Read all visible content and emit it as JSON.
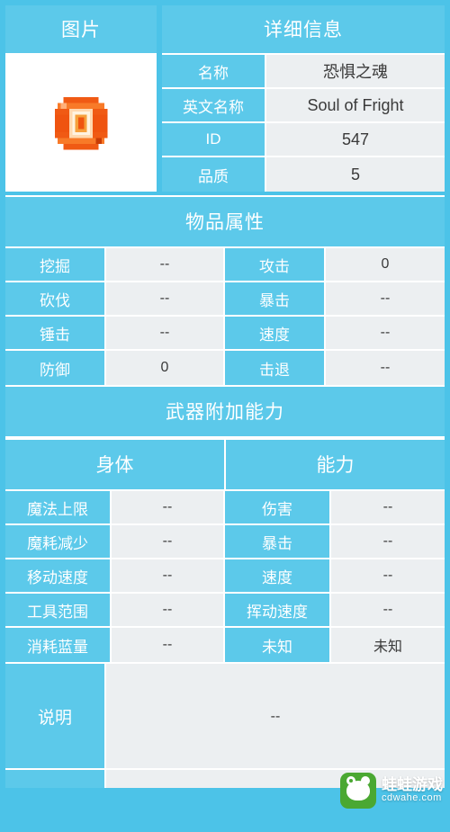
{
  "header": {
    "image_title": "图片",
    "detail_title": "详细信息"
  },
  "item": {
    "sprite_icon": "ring-item-icon",
    "fields": [
      {
        "label": "名称",
        "value": "恐惧之魂"
      },
      {
        "label": "英文名称",
        "value": "Soul of Fright"
      },
      {
        "label": "ID",
        "value": "547"
      },
      {
        "label": "品质",
        "value": "5"
      }
    ]
  },
  "attributes": {
    "title": "物品属性",
    "rows": [
      {
        "label_left": "挖掘",
        "value_left": "--",
        "label_right": "攻击",
        "value_right": "0"
      },
      {
        "label_left": "砍伐",
        "value_left": "--",
        "label_right": "暴击",
        "value_right": "--"
      },
      {
        "label_left": "锤击",
        "value_left": "--",
        "label_right": "速度",
        "value_right": "--"
      },
      {
        "label_left": "防御",
        "value_left": "0",
        "label_right": "击退",
        "value_right": "--"
      }
    ]
  },
  "weapon_bonus": {
    "title": "武器附加能力",
    "col_left": "身体",
    "col_right": "能力",
    "rows": [
      {
        "label_left": "魔法上限",
        "value_left": "--",
        "label_right": "伤害",
        "value_right": "--"
      },
      {
        "label_left": "魔耗减少",
        "value_left": "--",
        "label_right": "暴击",
        "value_right": "--"
      },
      {
        "label_left": "移动速度",
        "value_left": "--",
        "label_right": "速度",
        "value_right": "--"
      },
      {
        "label_left": "工具范围",
        "value_left": "--",
        "label_right": "挥动速度",
        "value_right": "--"
      },
      {
        "label_left": "消耗蓝量",
        "value_left": "--",
        "label_right": "未知",
        "value_right": "未知"
      }
    ]
  },
  "description": {
    "label": "说明",
    "value": "--"
  },
  "watermark": {
    "title": "蛙蛙游戏",
    "subtitle": "cdwahe.com",
    "icon": "frog-logo-icon"
  },
  "colors": {
    "accent": "#4cc3e8",
    "panel": "#5cc9ea",
    "value_bg": "#eceff1",
    "text_light": "#ffffff",
    "text_dark": "#3a3a3a"
  }
}
